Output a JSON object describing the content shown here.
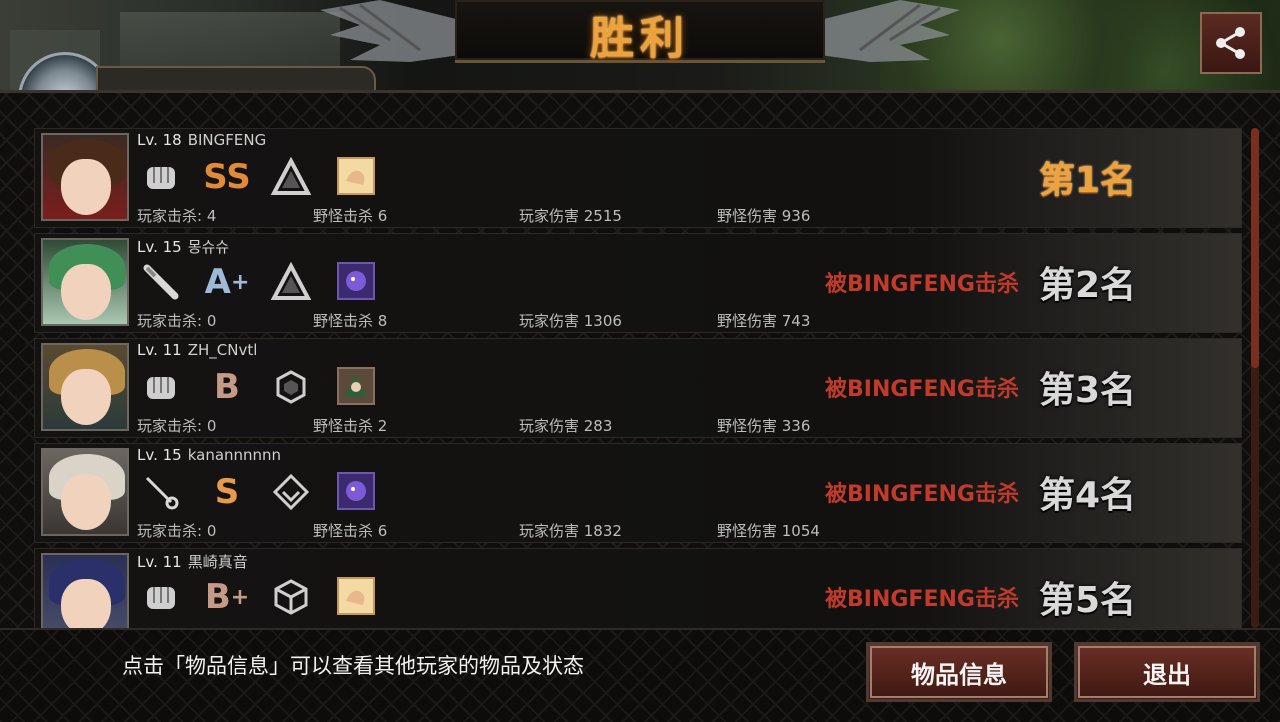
{
  "title": "胜利",
  "colors": {
    "accent_gold": "#f0a23a",
    "killed_red": "#c23a2a",
    "button_red": "#6a2f25"
  },
  "share_icon": "share-icon",
  "players": [
    {
      "level": "Lv. 18",
      "name": "BINGFENG",
      "weapon_icon": "fist-icon",
      "grade": "SS",
      "grade_plus": "",
      "grade_color": "#e08a3a",
      "mark_icon": "triangle-icon",
      "item_icon": "hand-item-icon",
      "player_kills": "玩家击杀: 4",
      "monster_kills": "野怪击杀 6",
      "player_damage": "玩家伤害 2515",
      "monster_damage": "野怪伤害 936",
      "killed_by": "",
      "rank": "第1名"
    },
    {
      "level": "Lv. 15",
      "name": "몽슈슈",
      "weapon_icon": "bat-icon",
      "grade": "A",
      "grade_plus": "+",
      "grade_color": "#9fb9d8",
      "mark_icon": "triangle-icon",
      "item_icon": "purple-creature-item-icon",
      "player_kills": "玩家击杀: 0",
      "monster_kills": "野怪击杀 8",
      "player_damage": "玩家伤害 1306",
      "monster_damage": "野怪伤害 743",
      "killed_by": "被BINGFENG击杀",
      "rank": "第2名"
    },
    {
      "level": "Lv. 11",
      "name": "ZH_CNvtl",
      "weapon_icon": "fist-icon",
      "grade": "B",
      "grade_plus": "",
      "grade_color": "#c59a86",
      "mark_icon": "hexagon-icon",
      "item_icon": "character-item-icon",
      "player_kills": "玩家击杀: 0",
      "monster_kills": "野怪击杀 2",
      "player_damage": "玩家伤害 283",
      "monster_damage": "野怪伤害 336",
      "killed_by": "被BINGFENG击杀",
      "rank": "第3名"
    },
    {
      "level": "Lv. 15",
      "name": "kanannnnnn",
      "weapon_icon": "rapier-icon",
      "grade": "S",
      "grade_plus": "",
      "grade_color": "#e89a4a",
      "mark_icon": "diamond-chevron-icon",
      "item_icon": "purple-creature-item-icon",
      "player_kills": "玩家击杀: 0",
      "monster_kills": "野怪击杀 6",
      "player_damage": "玩家伤害 1832",
      "monster_damage": "野怪伤害 1054",
      "killed_by": "被BINGFENG击杀",
      "rank": "第4名"
    },
    {
      "level": "Lv. 11",
      "name": "黒崎真音",
      "weapon_icon": "fist-icon",
      "grade": "B",
      "grade_plus": "+",
      "grade_color": "#c59a86",
      "mark_icon": "cube-icon",
      "item_icon": "hand-item-icon",
      "player_kills": "",
      "monster_kills": "",
      "player_damage": "",
      "monster_damage": "",
      "killed_by": "被BINGFENG击杀",
      "rank": "第5名"
    }
  ],
  "footer": {
    "hint": "点击「物品信息」可以查看其他玩家的物品及状态",
    "items_button": "物品信息",
    "exit_button": "退出"
  }
}
